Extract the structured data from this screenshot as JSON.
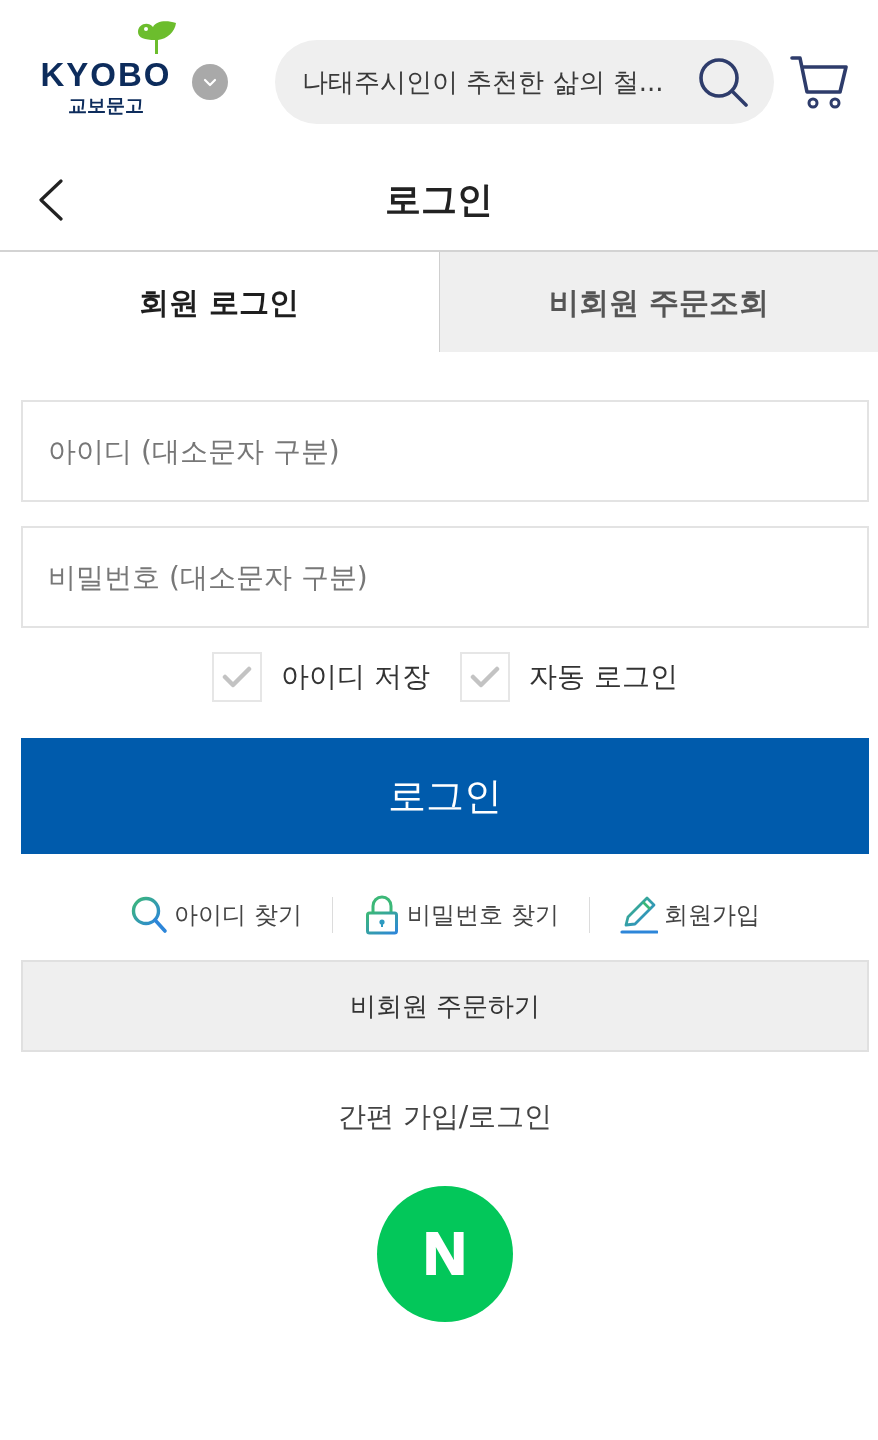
{
  "header": {
    "logo": {
      "wordmark": "KYOBO",
      "subtitle": "교보문고"
    },
    "search": {
      "placeholder": "나태주시인이 추천한 삶의 철..."
    }
  },
  "page_title": "로그인",
  "tabs": [
    {
      "label": "회원 로그인",
      "selected": true
    },
    {
      "label": "비회원 주문조회",
      "selected": false
    }
  ],
  "login_form": {
    "fields": [
      {
        "placeholder": "아이디 (대소문자 구분)"
      },
      {
        "placeholder": "비밀번호 (대소문자 구분)"
      }
    ],
    "options": [
      {
        "label": "아이디 저장",
        "checked": false
      },
      {
        "label": "자동 로그인",
        "checked": false
      }
    ],
    "submit_label": "로그인"
  },
  "help_links": [
    {
      "kind": "find-id",
      "label": "아이디 찾기"
    },
    {
      "kind": "find-password",
      "label": "비밀번호 찾기"
    },
    {
      "kind": "sign-up",
      "label": "회원가입"
    }
  ],
  "guest_order_button": "비회원 주문하기",
  "social_login": {
    "title": "간편 가입/로그인",
    "providers": [
      {
        "label": "N"
      }
    ]
  }
}
